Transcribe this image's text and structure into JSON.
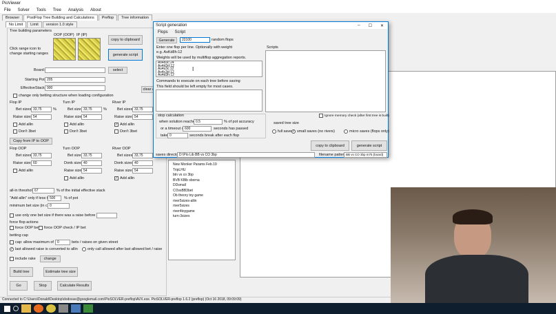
{
  "main": {
    "title": "PioViewer",
    "menu": [
      "File",
      "Solver",
      "Tools",
      "Tree",
      "Analysis",
      "About"
    ],
    "tabs": [
      "Browser",
      "PostFlop Tree Building and Calculations",
      "Preflop",
      "Tree information"
    ],
    "subtabs": [
      "No Limit",
      "Limit",
      "version 1.0 style"
    ],
    "tree_params_label": "Tree building parameters",
    "click_range_hint": "Click range icon to change starting ranges",
    "oop_label": "OOP (OOP)",
    "ip_label": "IP (IP)",
    "copy_clipboard": "copy to clipboard",
    "generate_script": "generate script",
    "board_label": "Board:",
    "select_btn": "select",
    "starting_pot_label": "Starting Pot:",
    "starting_pot": "205",
    "eff_stacks_label": "EffectiveStacks:",
    "eff_stacks": "900",
    "clear_all": "clear all",
    "change_only_betting": "change only betting structure when loading configuration",
    "flop_ip": "Flop IP",
    "turn_ip": "Turn IP",
    "river_ip": "River IP",
    "bet_sizes": "Bet sizes:",
    "raise_sizes": "Raise sizes:",
    "donk_sizes": "Donk sizes:",
    "add_allin": "Add allin",
    "dont_3bet": "Don't 3bet",
    "v_33_75": "33,75",
    "v_54": "54",
    "v_60": "60",
    "v_40": "40",
    "pct": "%",
    "copy_ip_oop": "Copy from IP to OOP",
    "flop_oop": "Flop OOP",
    "turn_oop": "Turn OOP",
    "river_oop": "River OOP",
    "allin_threshold_label": "all-in threshold",
    "allin_threshold": "67",
    "allin_threshold_tail": "% of the initial effective stack",
    "add_allin_only_label": "\"Add allin\" only if less than",
    "add_allin_only": "500",
    "pct_of_pot": "% of pot",
    "min_bet_label": "minimum bet size (in chips)",
    "min_bet": "0",
    "use_one_bet": "use only one bet size if there was a raise before",
    "force_flop_actions": "force flop actions",
    "force_oop_bet": "force OOP bet",
    "force_oop_check": "force OOP check / IP bet",
    "betting_cap": "betting cap",
    "cap_allow": "cap: allow maximum of",
    "cap_value": "0",
    "cap_tail": "bets / raises on given street",
    "last_allowed": "last allowed raise is converted to allin",
    "only_call": "only call allowed after last allowed bet / raise",
    "include_rake": "include rake",
    "change_btn": "change",
    "build_tree": "Build tree",
    "estimate_tree": "Estimate tree size",
    "go": "Go",
    "stop": "Stop",
    "calc_results": "Calculate Results",
    "tree_items": [
      "New Monker Params Feb.19",
      "TripLHU",
      "btn vs co 3bp",
      "BVB KBlb sborna",
      "DDsmall",
      "COvsBB3bet",
      "Ob theory toy game",
      "river5sizes-allin",
      "river5sizes",
      "river4toygame",
      "turn-3sizes"
    ],
    "status": "Connected to C:\\Users\\Donald\\Desktop\\dodosse@googlemail.com\\PioSOLVER-preflop\\AVX.exe. PioSOLVER-preflop 1.6.2 (preflop) (Oct 16 2018, 09:09:09)"
  },
  "dialog": {
    "title": "Script generation",
    "menu": [
      "Flops",
      "Script"
    ],
    "generate_btn": "Generate",
    "flop_count": "22100",
    "random_flops": "random flops",
    "hint1": "Enter one flop per line. Optionally with weight",
    "hint2": "e.g. AsKd8h:12",
    "weights_label": "Weights will be used by multiflop aggregation reports.",
    "flops": [
      "As4d3c:24",
      "As4d3d:12",
      "As4s3c:12",
      "As4c3d:12",
      "As4d3h:12"
    ],
    "scripts_label": "Scripts",
    "commands_label": "Commands to execute on each tree before saving",
    "commands_hint": "This field should be left empty for most cases.",
    "ignore_memory": "Ignore memory check (after first tree is built)",
    "stop_calc": "stop calculation",
    "when_solution": "when solution reaches",
    "accuracy_value": "0.5",
    "accuracy_tail": "% of pot accuracy",
    "timeout_label": "or a timeout of",
    "timeout_value": "600",
    "timeout_tail": "seconds has passed",
    "take_label": "take",
    "take_value": "0",
    "take_tail": "seconds break after each flop",
    "saved_tree_size": "saved tree size",
    "full_saves": "full saves",
    "small_saves": "small saves (no rivers)",
    "micro_saves": "micro saves (flops only)",
    "copy_clipboard": "copy to clipboard",
    "generate_script": "generate script",
    "saves_dir_label": "saves directory",
    "saves_dir": "D:\\Pio Lib BB vs CO 3bp",
    "filename_label": "filename pattern",
    "filename": "BB vs CO 3bp m75 (board)"
  },
  "colors": {
    "taskbar": "#0f1e2e",
    "accent": "#0078d7",
    "range_yellow": "#d9d24a"
  }
}
